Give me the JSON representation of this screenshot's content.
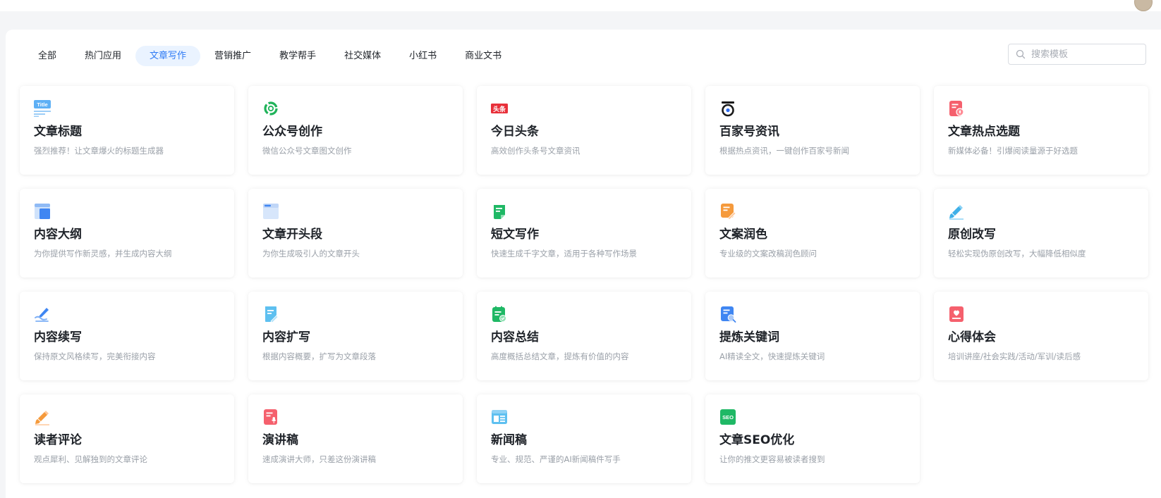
{
  "tabs": [
    {
      "label": "全部",
      "active": false
    },
    {
      "label": "热门应用",
      "active": false
    },
    {
      "label": "文章写作",
      "active": true
    },
    {
      "label": "营销推广",
      "active": false
    },
    {
      "label": "教学帮手",
      "active": false
    },
    {
      "label": "社交媒体",
      "active": false
    },
    {
      "label": "小红书",
      "active": false
    },
    {
      "label": "商业文书",
      "active": false
    }
  ],
  "search": {
    "placeholder": "搜索模板",
    "value": ""
  },
  "cards": [
    {
      "title": "文章标题",
      "desc": "强烈推荐！让文章爆火的标题生成器",
      "icon": "title-icon"
    },
    {
      "title": "公众号创作",
      "desc": "微信公众号文章图文创作",
      "icon": "wechat-icon"
    },
    {
      "title": "今日头条",
      "desc": "高效创作头条号文章资讯",
      "icon": "toutiao-icon"
    },
    {
      "title": "百家号资讯",
      "desc": "根据热点资讯，一键创作百家号新闻",
      "icon": "baijiahao-icon"
    },
    {
      "title": "文章热点选题",
      "desc": "新媒体必备！引爆阅读量源于好选题",
      "icon": "hot-topic-icon"
    },
    {
      "title": "内容大纲",
      "desc": "为你提供写作新灵感，并生成内容大纲",
      "icon": "outline-icon"
    },
    {
      "title": "文章开头段",
      "desc": "为你生成吸引人的文章开头",
      "icon": "opening-paragraph-icon"
    },
    {
      "title": "短文写作",
      "desc": "快速生成千字文章，适用于各种写作场景",
      "icon": "short-writing-icon"
    },
    {
      "title": "文案润色",
      "desc": "专业级的文案改稿润色顾问",
      "icon": "polish-icon"
    },
    {
      "title": "原创改写",
      "desc": "轻松实现伪原创改写，大幅降低相似度",
      "icon": "rewrite-pencil-icon"
    },
    {
      "title": "内容续写",
      "desc": "保持原文风格续写，完美衔接内容",
      "icon": "continue-writing-icon"
    },
    {
      "title": "内容扩写",
      "desc": "根据内容概要，扩写为文章段落",
      "icon": "expand-writing-icon"
    },
    {
      "title": "内容总结",
      "desc": "高度概括总结文章，提炼有价值的内容",
      "icon": "summary-icon"
    },
    {
      "title": "提炼关键词",
      "desc": "AI精读全文，快速提炼关键词",
      "icon": "keyword-icon"
    },
    {
      "title": "心得体会",
      "desc": "培训讲座/社会实践/活动/军训/读后感",
      "icon": "reflection-icon"
    },
    {
      "title": "读者评论",
      "desc": "观点犀利、见解独到的文章评论",
      "icon": "comment-pencil-icon"
    },
    {
      "title": "演讲稿",
      "desc": "速成演讲大师，只差这份演讲稿",
      "icon": "speech-icon"
    },
    {
      "title": "新闻稿",
      "desc": "专业、规范、严谨的AI新闻稿件写手",
      "icon": "news-icon"
    },
    {
      "title": "文章SEO优化",
      "desc": "让你的推文更容易被读者搜到",
      "icon": "seo-icon"
    }
  ],
  "icon_text": {
    "title_badge": "Title",
    "toutiao_badge": "头条",
    "seo_badge": "SEO"
  },
  "colors": {
    "accent": "#2f7bf5",
    "active_tab_bg": "#eaf3ff",
    "background": "#f4f5f7"
  }
}
